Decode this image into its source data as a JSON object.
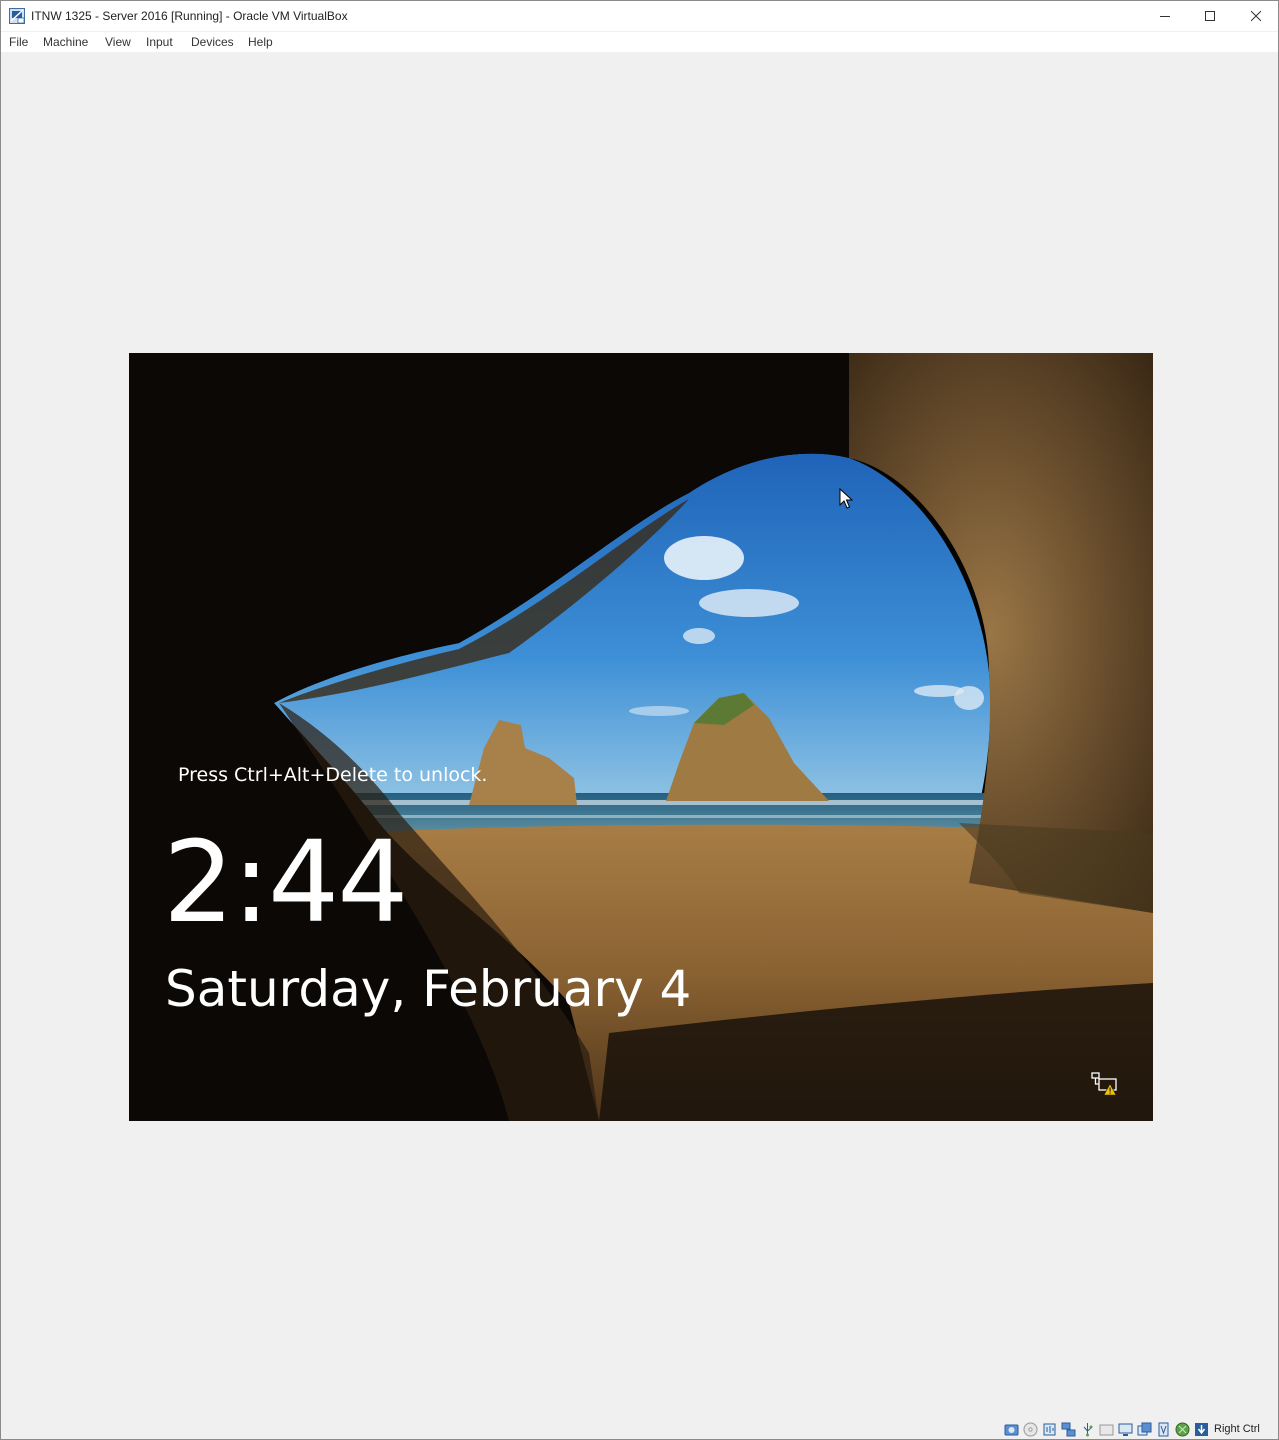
{
  "window": {
    "title": "ITNW 1325 - Server 2016 [Running] - Oracle VM VirtualBox",
    "icons": [
      "virtualbox-vm-icon",
      "minimize-icon",
      "maximize-icon",
      "close-icon"
    ]
  },
  "menubar": {
    "items": [
      {
        "label": "File"
      },
      {
        "label": "Machine"
      },
      {
        "label": "View"
      },
      {
        "label": "Input"
      },
      {
        "label": "Devices"
      },
      {
        "label": "Help"
      }
    ]
  },
  "lockscreen": {
    "hint": "Press Ctrl+Alt+Delete to unlock.",
    "time": "2:44",
    "date": "Saturday, February 4",
    "network_status_icon": "network-warning-icon"
  },
  "statusbar": {
    "icons": [
      "hard-disk-icon",
      "optical-drive-icon",
      "audio-icon",
      "network-icon",
      "usb-icon",
      "shared-folders-icon",
      "display-icon",
      "video-capture-icon",
      "cpu-icon",
      "mouse-integration-icon",
      "keyboard-icon"
    ],
    "host_key": "Right Ctrl"
  },
  "colors": {
    "titlebar_bg": "#ffffff",
    "window_bg": "#f0f0f0",
    "lock_text": "#ffffff"
  }
}
